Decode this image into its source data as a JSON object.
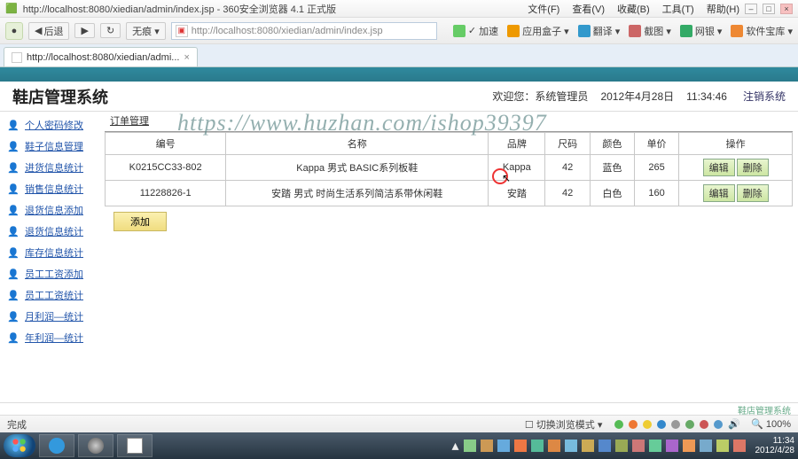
{
  "browser": {
    "title": "http://localhost:8080/xiedian/admin/index.jsp - 360安全浏览器 4.1 正式版",
    "menus": [
      "文件(F)",
      "查看(V)",
      "收藏(B)",
      "工具(T)",
      "帮助(H)"
    ],
    "nav": {
      "back": "后退",
      "forward": "",
      "reload": "",
      "prefix": "无痕 ▾"
    },
    "url": "http://localhost:8080/xiedian/admin/index.jsp",
    "rightlinks": {
      "jiasu": "加速",
      "appbox": "应用盒子 ▾",
      "translate": "翻译 ▾",
      "screenshot": "截图 ▾",
      "netbank": "网银 ▾",
      "softstore": "软件宝库 ▾"
    },
    "tab_label": "http://localhost:8080/xiedian/admi...",
    "status_done": "完成",
    "status_mode": "切换浏览模式 ▾",
    "zoom": "100%"
  },
  "app": {
    "title": "鞋店管理系统",
    "welcome": "欢迎您：系统管理员",
    "date": "2012年4月28日",
    "time": "11:34:46",
    "logout": "注销系统",
    "footer": "鞋店管理系统"
  },
  "sidebar": {
    "items": [
      {
        "label": "个人密码修改"
      },
      {
        "label": "鞋子信息管理"
      },
      {
        "label": "进货信息统计"
      },
      {
        "label": "销售信息统计"
      },
      {
        "label": "退货信息添加"
      },
      {
        "label": "退货信息统计"
      },
      {
        "label": "库存信息统计"
      },
      {
        "label": "员工工资添加"
      },
      {
        "label": "员工工资统计"
      },
      {
        "label": "月利润—统计"
      },
      {
        "label": "年利润—统计"
      }
    ]
  },
  "panel": {
    "title": "订单管理",
    "columns": [
      "编号",
      "名称",
      "品牌",
      "尺码",
      "颜色",
      "单价",
      "操作"
    ],
    "rows": [
      {
        "id": "K0215CC33-802",
        "name": "Kappa 男式  BASIC系列板鞋",
        "brand": "Kappa",
        "size": "42",
        "color": "蓝色",
        "price": "265"
      },
      {
        "id": "11228826-1",
        "name": "安踏 男式 时尚生活系列简洁系带休闲鞋",
        "brand": "安踏",
        "size": "42",
        "color": "白色",
        "price": "160"
      }
    ],
    "op_edit": "编辑",
    "op_del": "删除",
    "add": "添加"
  },
  "watermark": "https://www.huzhan.com/ishop39397",
  "taskbar": {
    "time": "11:34",
    "date": "2012/4/28"
  }
}
